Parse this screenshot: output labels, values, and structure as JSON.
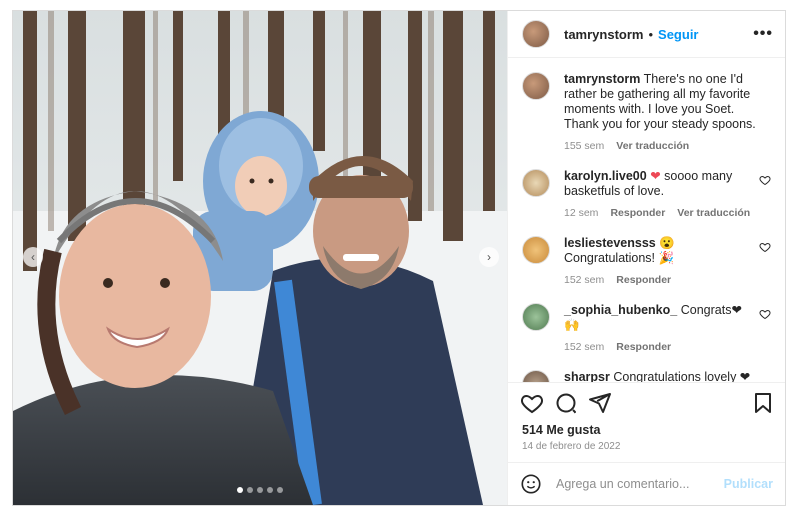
{
  "post": {
    "username": "tamrynstorm",
    "follow_label": "Seguir",
    "more_label": "•••",
    "caption": {
      "username": "tamrynstorm",
      "text": "There's no one I'd rather be gathering all my favorite moments with. I love you Soet. Thank you for your steady spoons.",
      "time": "155 sem",
      "translate_label": "Ver traducción"
    },
    "comments": [
      {
        "username": "karolyn.live00",
        "text_before": "",
        "emoji": "❤",
        "text": " soooo many basketfuls of love.",
        "time": "12 sem",
        "reply_label": "Responder",
        "translate_label": "Ver traducción"
      },
      {
        "username": "lesliestevensss",
        "text_before": "",
        "emoji": "😮",
        "text": "Congratulations! 🎉",
        "time": "152 sem",
        "reply_label": "Responder",
        "translate_label": ""
      },
      {
        "username": "_sophia_hubenko_",
        "text_before": "",
        "emoji": "",
        "text": "Congrats❤🙌",
        "time": "152 sem",
        "reply_label": "Responder",
        "translate_label": ""
      },
      {
        "username": "sharpsr",
        "text_before": "",
        "emoji": "",
        "text": "Congratulations lovely ❤",
        "time": "",
        "reply_label": "",
        "translate_label": ""
      }
    ],
    "likes": "514 Me gusta",
    "date": "14 de febrero de 2022",
    "comment_placeholder": "Agrega un comentario...",
    "publish_label": "Publicar",
    "carousel": {
      "total": 5,
      "active": 0
    }
  },
  "colors": {
    "accent": "#0095f6",
    "heart": "#ed4956",
    "publish_disabled": "#b2dffc"
  }
}
